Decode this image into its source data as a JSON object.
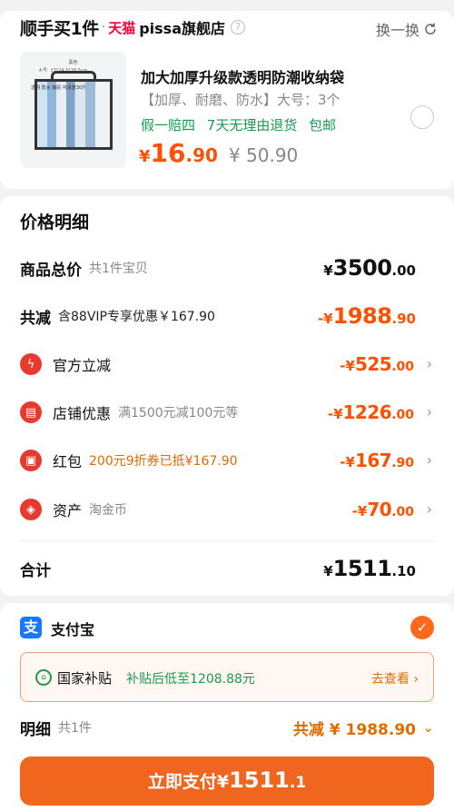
{
  "shop": {
    "brand": "顺手买1件",
    "separator": "·",
    "platform": "天猫",
    "name": "pissa旗舰店",
    "help_glyph": "?",
    "swap_label": "换一换"
  },
  "product": {
    "thumb_label_color": "黑色",
    "thumb_label_size": "大号: 37*24.5*28.5cm",
    "thumb_label_features": "透明 防水 抽屉 可承重30斤",
    "title": "加大加厚升级款透明防潮收纳袋",
    "spec": "【加厚、耐磨、防水】大号：3个",
    "tags": [
      "假一赔四",
      "7天无理由退货",
      "包邮"
    ],
    "price_symbol": "¥",
    "price_int": "16",
    "price_dec": ".90",
    "original_price": "¥ 50.90"
  },
  "breakdown": {
    "title": "价格明细",
    "total": {
      "label": "商品总价",
      "sub": "共1件宝贝",
      "sym": "¥",
      "int": "3500",
      "dec": ".00"
    },
    "reduce": {
      "label": "共减",
      "sub": "含88VIP专享优惠￥167.90",
      "sym": "-¥",
      "int": "1988",
      "dec": ".90"
    },
    "items": [
      {
        "label": "官方立减",
        "sub": "",
        "sym": "-¥",
        "int": "525",
        "dec": ".00",
        "icon": "lightning-icon",
        "glyph": "ϟ"
      },
      {
        "label": "店铺优惠",
        "sub": "满1500元减100元等",
        "sym": "-¥",
        "int": "1226",
        "dec": ".00",
        "icon": "shop-icon",
        "glyph": "▤"
      },
      {
        "label": "红包",
        "sub": "200元9折券已抵¥167.90",
        "sym": "-¥",
        "int": "167",
        "dec": ".90",
        "icon": "red-packet-icon",
        "glyph": "▣"
      },
      {
        "label": "资产",
        "sub": "淘金币",
        "sym": "-¥",
        "int": "70",
        "dec": ".00",
        "icon": "tag-icon",
        "glyph": "◈"
      }
    ],
    "sum": {
      "label": "合计",
      "sym": "¥",
      "int": "1511",
      "dec": ".10"
    },
    "chevron": "›"
  },
  "payment": {
    "method_glyph": "支",
    "method": "支付宝",
    "check_glyph": "✓",
    "subsidy_glyph": "⌂",
    "subsidy_name": "国家补贴",
    "subsidy_desc": "补贴后低至1208.88元",
    "subsidy_link": "去查看 ›",
    "detail_label": "明细",
    "detail_sub": "共1件",
    "detail_reduce": "共减 ¥ 1988.90",
    "detail_chevron": "⌄",
    "pay_text": "立即支付",
    "pay_sym": "¥",
    "pay_int": "1511",
    "pay_dec": ".1"
  },
  "colors": {
    "accent": "#f0661f",
    "price": "#ff5000",
    "green": "#1a9b52",
    "tmall": "#ff0036",
    "alipay": "#1677ff"
  }
}
